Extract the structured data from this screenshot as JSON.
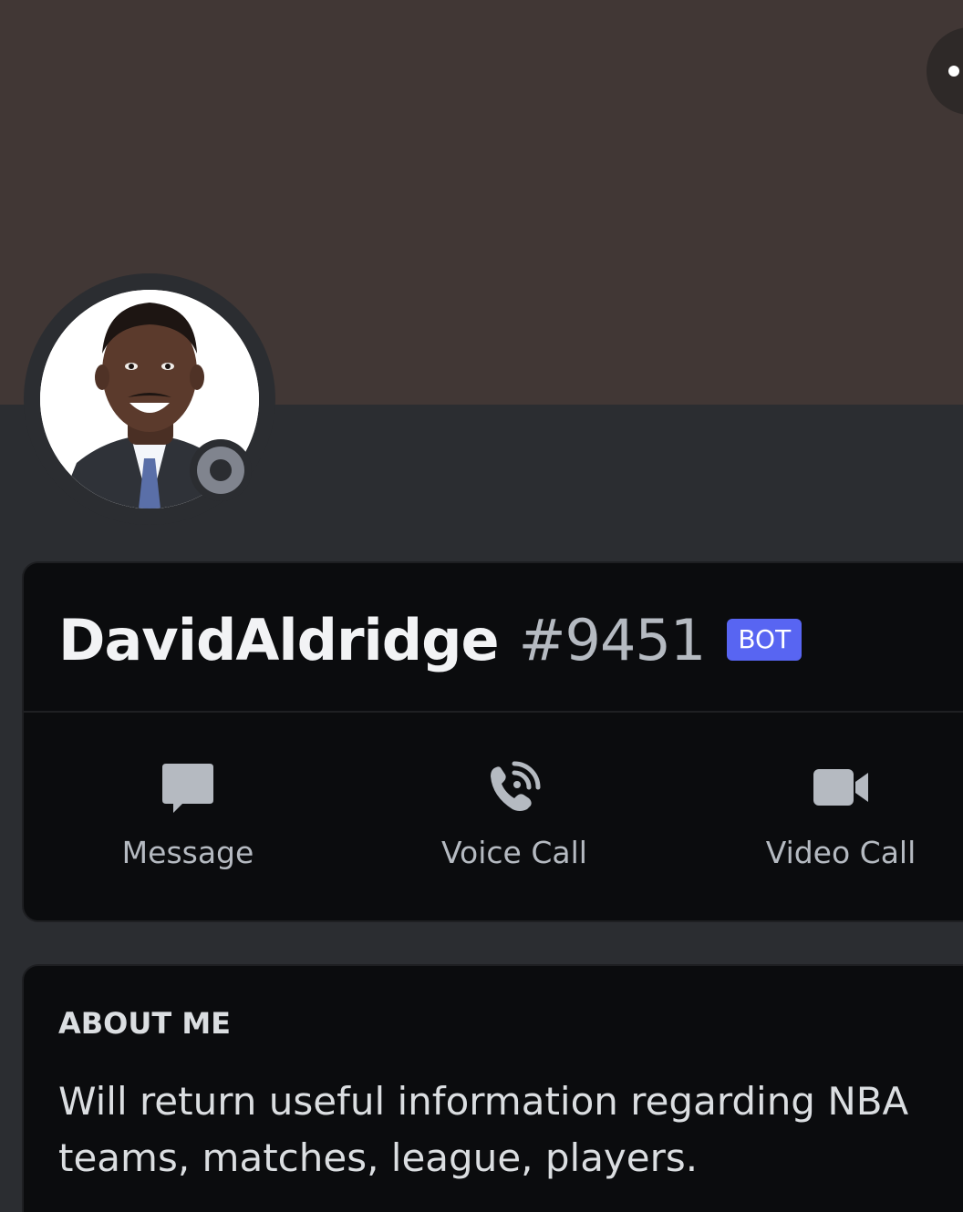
{
  "profile": {
    "username": "DavidAldridge",
    "discriminator": "#9451",
    "badge": "BOT",
    "status": "offline"
  },
  "actions": [
    {
      "label": "Message",
      "icon": "chat-bubble-icon"
    },
    {
      "label": "Voice Call",
      "icon": "phone-call-icon"
    },
    {
      "label": "Video Call",
      "icon": "video-camera-icon"
    }
  ],
  "about": {
    "heading": "ABOUT ME",
    "text": "Will return useful information regarding NBA teams, matches, league, players."
  },
  "colors": {
    "banner": "#413735",
    "background": "#2b2d31",
    "card": "#0b0c0e",
    "badge": "#5865f2",
    "status_offline": "#80848e"
  }
}
